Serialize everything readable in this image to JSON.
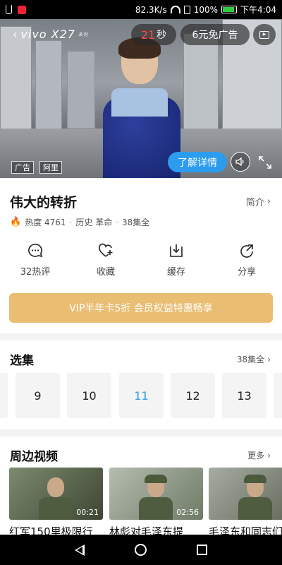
{
  "status_bar": {
    "speed": "82.3K/s",
    "battery": "100%",
    "time": "下午4:04"
  },
  "ad": {
    "brand": "vivo X27",
    "brand_sub": "系列",
    "timer_number": "21",
    "timer_unit": "秒",
    "skip_label": "6元免广告",
    "tag_ad": "广告",
    "tag_source": "阿里",
    "learn_more": "了解详情"
  },
  "show": {
    "title": "伟大的转折",
    "intro_label": "简介",
    "heat_label": "热度 4761",
    "genres": "历史 革命",
    "episode_total": "38集全"
  },
  "actions": [
    {
      "label": "32热评",
      "icon": "comment-icon"
    },
    {
      "label": "收藏",
      "icon": "favorite-add-icon"
    },
    {
      "label": "缓存",
      "icon": "download-icon"
    },
    {
      "label": "分享",
      "icon": "share-icon"
    }
  ],
  "vip_banner": "VIP半年卡5折 会员权益特惠畅享",
  "episodes_section": {
    "title": "选集",
    "more": "38集全",
    "items": [
      "9",
      "10",
      "11",
      "12",
      "13"
    ],
    "active": "11"
  },
  "related_section": {
    "title": "周边视频",
    "more": "更多",
    "items": [
      {
        "title": "红军150里极限行",
        "duration": "00:21"
      },
      {
        "title": "林彪对毛泽东提",
        "duration": "02:56"
      },
      {
        "title": "毛泽东和同志们",
        "duration": "01"
      }
    ]
  },
  "colors": {
    "accent_blue": "#2d9cee",
    "vip_gold": "#e9bd72",
    "timer_red": "#ff4a3d",
    "fire_orange": "#ff5a1f"
  }
}
